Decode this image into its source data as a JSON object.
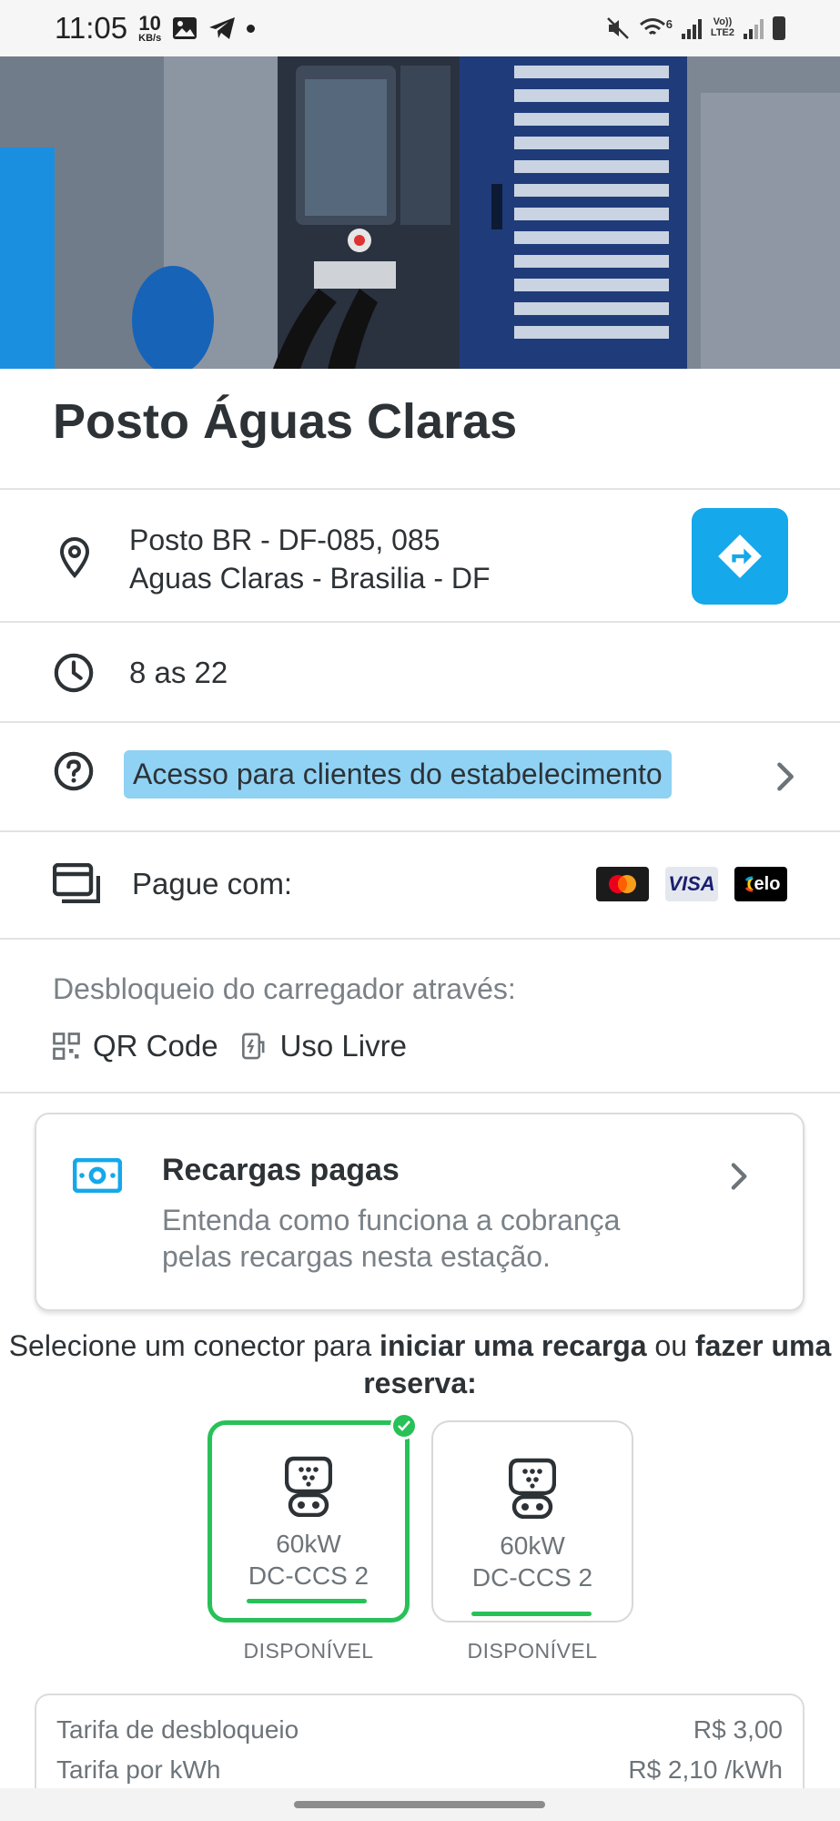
{
  "status_bar": {
    "time": "11:05",
    "kb_value": "10",
    "kb_unit": "KB/s",
    "lte_label_1": "Vo))",
    "lte_label_2": "LTE2",
    "wifi_label": "6"
  },
  "station": {
    "name": "Posto Águas Claras",
    "address_line1": "Posto BR - DF-085, 085",
    "address_line2": "Aguas Claras - Brasilia - DF",
    "hours": "8 as 22",
    "access": "Acesso para clientes do estabelecimento",
    "pay_label": "Pague com:",
    "payment_methods": [
      "mastercard",
      "VISA",
      "elo"
    ],
    "unlock_title": "Desbloqueio do carregador através:",
    "unlock_options": [
      "QR Code",
      "Uso Livre"
    ]
  },
  "paid_card": {
    "title": "Recargas pagas",
    "description": "Entenda como funciona a cobrança pelas recargas nesta estação."
  },
  "select": {
    "part1": "Selecione um conector para ",
    "bold1": "iniciar uma recarga",
    "part2": " ou ",
    "bold2": "fazer uma reserva:"
  },
  "connectors": [
    {
      "power": "60kW",
      "type": "DC-CCS 2",
      "status": "DISPONÍVEL",
      "selected": true
    },
    {
      "power": "60kW",
      "type": "DC-CCS 2",
      "status": "DISPONÍVEL",
      "selected": false
    }
  ],
  "tariffs": [
    {
      "label": "Tarifa de desbloqueio",
      "value": "R$ 3,00"
    },
    {
      "label": "Tarifa por kWh",
      "value": "R$ 2,10 /kWh"
    }
  ],
  "colors": {
    "accent_blue": "#15a8ea",
    "access_highlight": "#8fd2f4",
    "available_green": "#27c158"
  }
}
